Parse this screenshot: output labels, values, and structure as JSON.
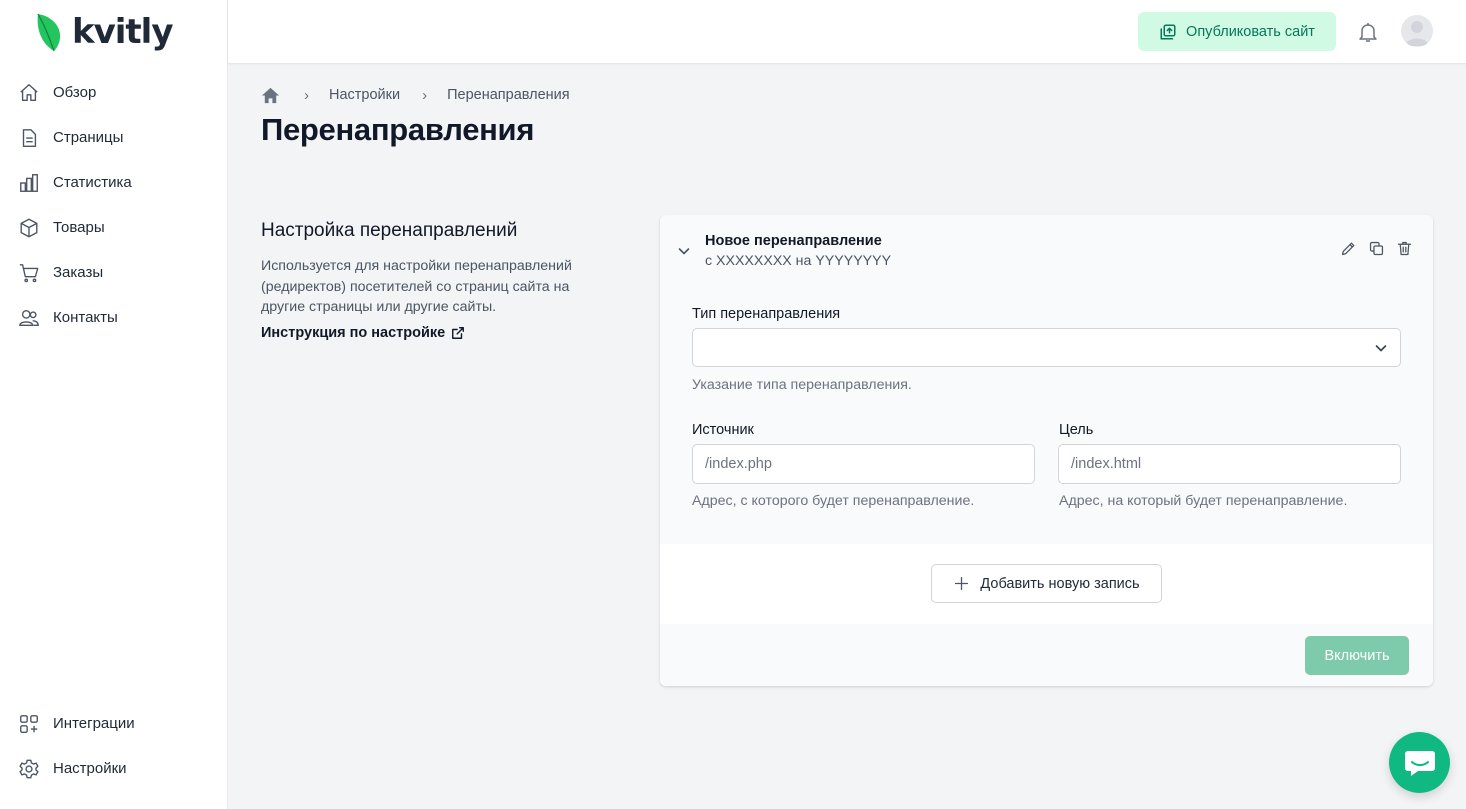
{
  "brand": {
    "name": "kvitly",
    "color": "#10b981"
  },
  "sidebar": {
    "items": [
      {
        "label": "Обзор",
        "icon": "home-icon"
      },
      {
        "label": "Страницы",
        "icon": "document-icon"
      },
      {
        "label": "Статистика",
        "icon": "chart-bar-icon"
      },
      {
        "label": "Товары",
        "icon": "cube-icon"
      },
      {
        "label": "Заказы",
        "icon": "cart-icon"
      },
      {
        "label": "Контакты",
        "icon": "users-icon"
      }
    ],
    "bottom": [
      {
        "label": "Интеграции",
        "icon": "integrations-icon"
      },
      {
        "label": "Настройки",
        "icon": "gear-icon"
      }
    ]
  },
  "header": {
    "publish_label": "Опубликовать сайт"
  },
  "breadcrumb": {
    "items": [
      "Настройки",
      "Перенаправления"
    ]
  },
  "page": {
    "title": "Перенаправления"
  },
  "section": {
    "title": "Настройка перенаправлений",
    "description": "Используется для настройки перенаправлений (редиректов) посетителей со страниц сайта на другие страницы или другие сайты.",
    "link_label": "Инструкция по настройке"
  },
  "redirect": {
    "title": "Новое перенаправление",
    "subtitle": "с XXXXXXXX на YYYYYYYY",
    "type_label": "Тип перенаправления",
    "type_value": "",
    "type_help": "Указание типа перенаправления.",
    "source_label": "Источник",
    "source_placeholder": "/index.php",
    "source_help": "Адрес, с которого будет перенаправление.",
    "target_label": "Цель",
    "target_placeholder": "/index.html",
    "target_help": "Адрес, на который будет перенаправление."
  },
  "actions": {
    "add_label": "Добавить новую запись",
    "enable_label": "Включить"
  }
}
